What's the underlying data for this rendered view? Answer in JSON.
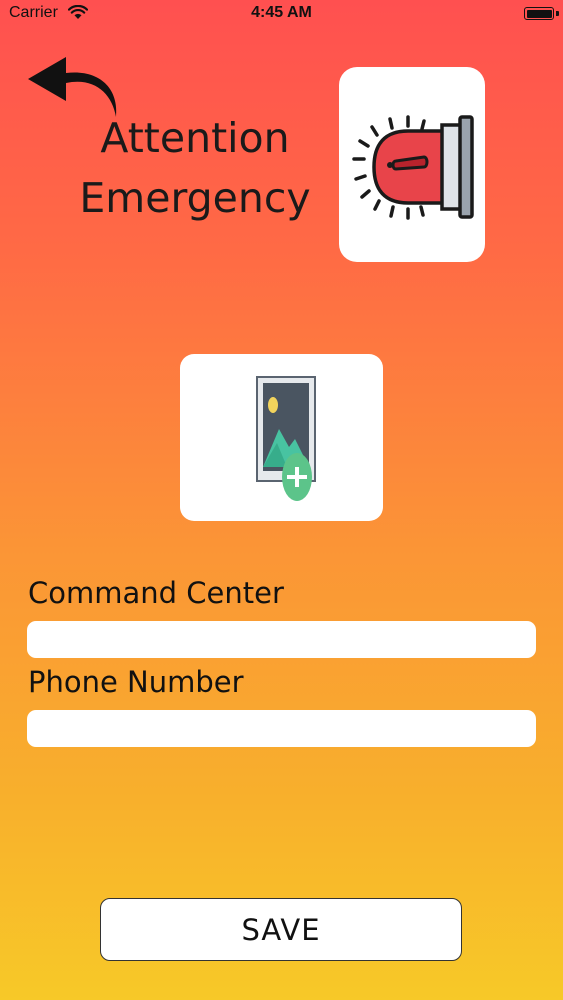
{
  "status_bar": {
    "carrier": "Carrier",
    "time": "4:45 AM"
  },
  "header": {
    "title_line1": "Attention",
    "title_line2": "Emergency",
    "back_icon": "back-arrow-icon",
    "siren_icon": "siren-icon"
  },
  "photo_picker": {
    "icon": "add-photo-icon"
  },
  "form": {
    "command_center_label": "Command Center",
    "command_center_value": "",
    "phone_number_label": "Phone Number",
    "phone_number_value": ""
  },
  "save_label": "SAVE",
  "colors": {
    "gradient_top": "#ff5050",
    "gradient_bottom": "#f7c928",
    "siren_red": "#e8444a",
    "plus_green": "#5cc48a"
  }
}
